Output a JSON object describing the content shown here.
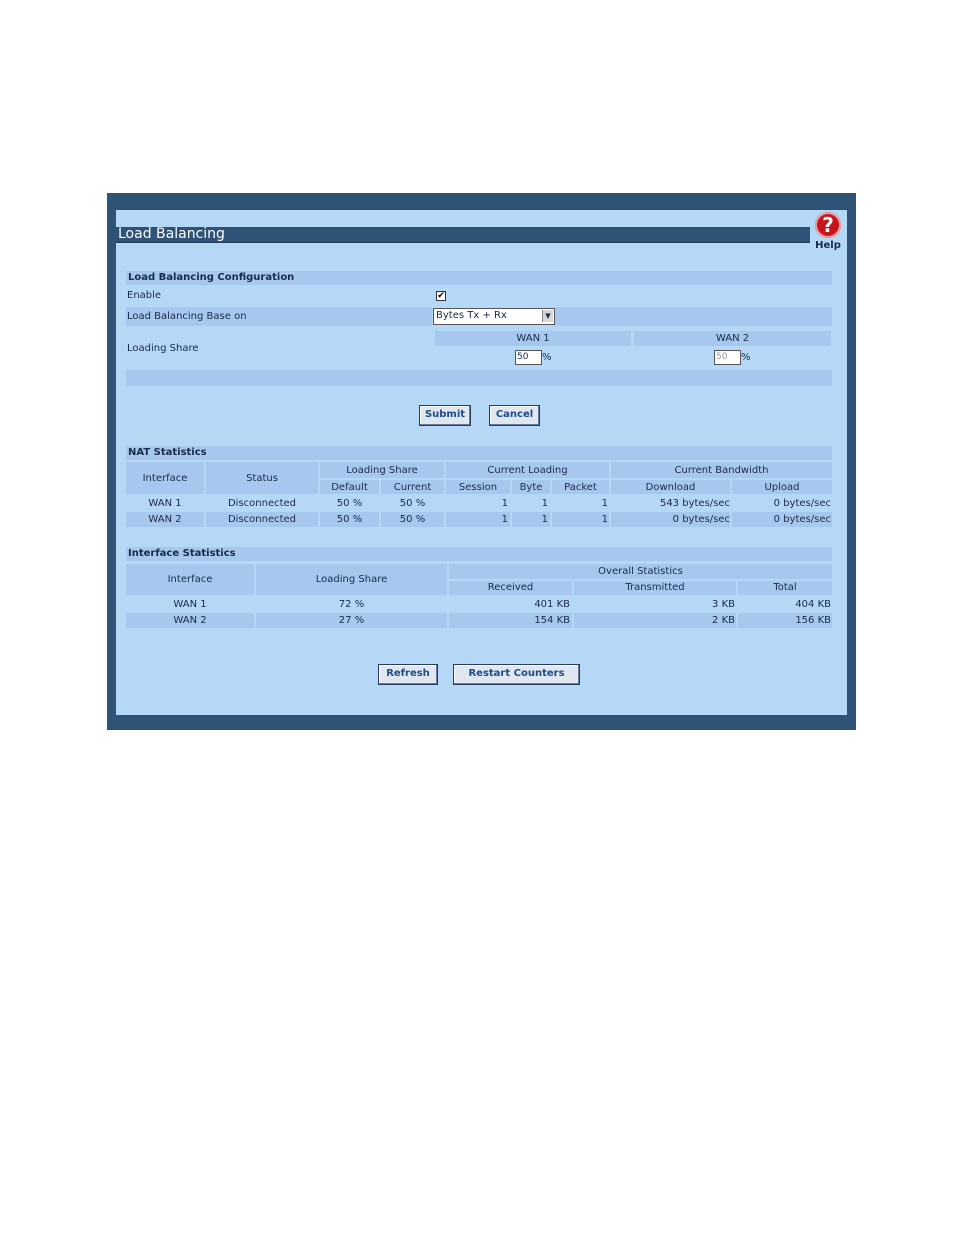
{
  "window": {
    "title": "Load Balancing",
    "help_label": "Help",
    "help_glyph": "?"
  },
  "config": {
    "section_title": "Load Balancing Configuration",
    "enable_label": "Enable",
    "enable_checked": true,
    "base_label": "Load Balancing Base on",
    "base_value": "Bytes Tx + Rx",
    "share_label": "Loading Share",
    "wan1_header": "WAN 1",
    "wan2_header": "WAN 2",
    "wan1_value": "50",
    "wan2_value": "50",
    "percent": "%",
    "submit_label": "Submit",
    "cancel_label": "Cancel"
  },
  "nat": {
    "section_title": "NAT Statistics",
    "headers": {
      "interface": "Interface",
      "status": "Status",
      "loading_share": "Loading Share",
      "current_loading": "Current Loading",
      "current_bandwidth": "Current Bandwidth",
      "default": "Default",
      "current": "Current",
      "session": "Session",
      "byte": "Byte",
      "packet": "Packet",
      "download": "Download",
      "upload": "Upload"
    },
    "rows": [
      {
        "interface": "WAN 1",
        "status": "Disconnected",
        "default": "50 %",
        "current": "50 %",
        "session": "1",
        "byte": "1",
        "packet": "1",
        "download": "543 bytes/sec",
        "upload": "0 bytes/sec"
      },
      {
        "interface": "WAN 2",
        "status": "Disconnected",
        "default": "50 %",
        "current": "50 %",
        "session": "1",
        "byte": "1",
        "packet": "1",
        "download": "0 bytes/sec",
        "upload": "0 bytes/sec"
      }
    ]
  },
  "iface": {
    "section_title": "Interface Statistics",
    "headers": {
      "interface": "Interface",
      "loading_share": "Loading Share",
      "overall": "Overall Statistics",
      "received": "Received",
      "transmitted": "Transmitted",
      "total": "Total"
    },
    "rows": [
      {
        "interface": "WAN 1",
        "share": "72 %",
        "received": "401 KB",
        "transmitted": "3 KB",
        "total": "404 KB"
      },
      {
        "interface": "WAN 2",
        "share": "27 %",
        "received": "154 KB",
        "transmitted": "2 KB",
        "total": "156 KB"
      }
    ]
  },
  "actions": {
    "refresh_label": "Refresh",
    "restart_label": "Restart Counters"
  }
}
